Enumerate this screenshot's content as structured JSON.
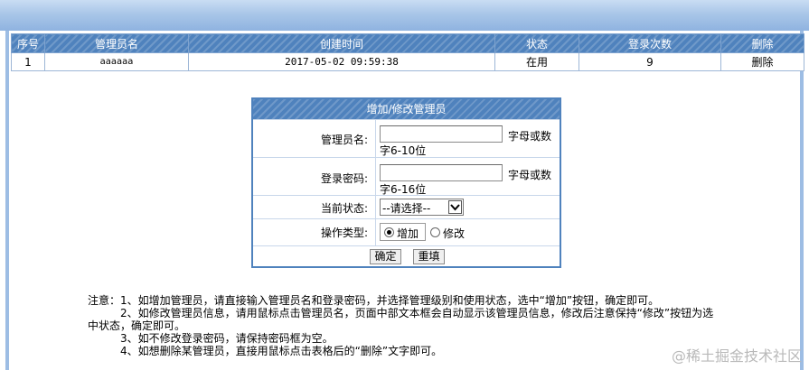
{
  "table": {
    "headers": [
      "序号",
      "管理员名",
      "创建时间",
      "状态",
      "登录次数",
      "删除"
    ],
    "rows": [
      {
        "index": "1",
        "username": "aaaaaa",
        "created": "2017-05-02 09:59:38",
        "status": "在用",
        "logins": "9",
        "delete": "删除"
      }
    ]
  },
  "form": {
    "title": "增加/修改管理员",
    "username_label": "管理员名:",
    "username_hint_1": "字母或数",
    "username_hint_2": "字6-10位",
    "password_label": "登录密码:",
    "password_hint_1": "字母或数",
    "password_hint_2": "字6-16位",
    "status_label": "当前状态:",
    "status_selected": "--请选择--",
    "optype_label": "操作类型:",
    "optype_add": "增加",
    "optype_edit": "修改",
    "ok_button": "确定",
    "reset_button": "重填"
  },
  "notes": {
    "line1": "注意：1、如增加管理员，请直接输入管理员名和登录密码，并选择管理级别和使用状态，选中“增加”按钮，确定即可。",
    "line2": "2、如修改管理员信息，请用鼠标点击管理员名，页面中部文本框会自动显示该管理员信息，修改后注意保持“修改”按钮为选",
    "line3": "中状态，确定即可。",
    "line4": "3、如不修改登录密码，请保持密码框为空。",
    "line5": "4、如想删除某管理员，直接用鼠标点击表格后的“删除”文字即可。"
  },
  "watermark": "@稀土掘金技术社区"
}
